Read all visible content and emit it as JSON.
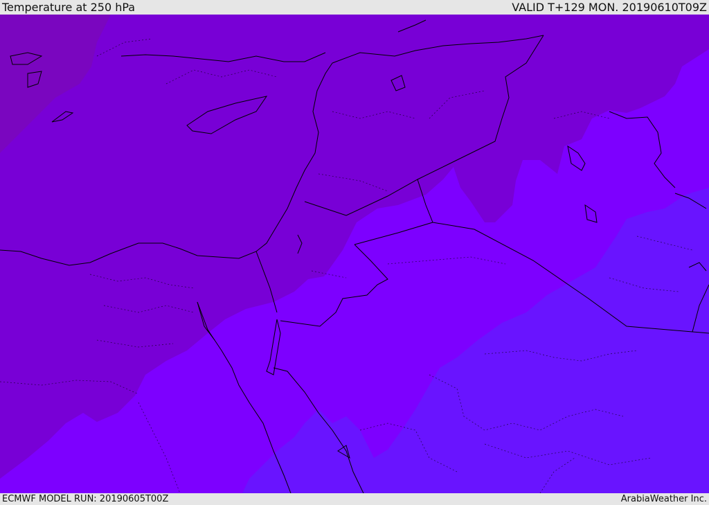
{
  "header": {
    "title": "Temperature at 250 hPa",
    "valid": "VALID T+129 MON. 20190610T09Z"
  },
  "footer": {
    "model_run": "ECMWF MODEL RUN: 20190605T00Z",
    "credit": "ArabiaWeather Inc."
  },
  "colors": {
    "band_coldest": "#7a06bf",
    "band_cold": "#7800d6",
    "band_mid": "#7d00ff",
    "band_warm": "#6914ff",
    "coast": "#000000",
    "border": "#000000",
    "header_bg": "#e6e6e6"
  }
}
